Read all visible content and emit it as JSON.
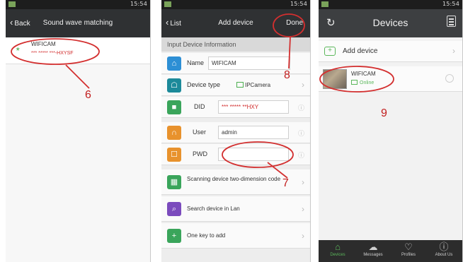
{
  "screen1": {
    "status_time": "15:54",
    "back_label": "Back",
    "title": "Sound wave matching",
    "device": {
      "name": "WIFICAM",
      "id": "*** ***** ***-HXYSF"
    },
    "annotation": "6"
  },
  "screen2": {
    "status_time": "15:54",
    "back_label": "List",
    "title": "Add device",
    "done_label": "Done",
    "section_label": "Input Device Information",
    "fields": {
      "name": {
        "label": "Name",
        "value": "WIFICAM"
      },
      "device_type": {
        "label": "Device type",
        "value": "IPCamera"
      },
      "did": {
        "label": "DID",
        "value": "*** ***** **HXY"
      },
      "user": {
        "label": "User",
        "value": "admin"
      },
      "pwd": {
        "label": "PWD",
        "value": ""
      }
    },
    "actions": [
      {
        "label": "Scanning device two-dimension code",
        "icon": "qrcode-icon"
      },
      {
        "label": "Search device in Lan",
        "icon": "search-icon"
      },
      {
        "label": "One key to add",
        "icon": "plus-icon"
      }
    ],
    "annotations": {
      "pwd": "7",
      "done": "8"
    }
  },
  "screen3": {
    "status_time": "15:54",
    "title": "Devices",
    "add_label": "Add device",
    "device": {
      "name": "WIFICAM",
      "status": "Online"
    },
    "tabs": [
      {
        "label": "Devices",
        "icon": "home-icon",
        "active": true
      },
      {
        "label": "Messages",
        "icon": "cloud-icon",
        "active": false
      },
      {
        "label": "Profiles",
        "icon": "heart-icon",
        "active": false
      },
      {
        "label": "About Us",
        "icon": "info-icon",
        "active": false
      }
    ],
    "annotation": "9"
  },
  "colors": {
    "annotation": "#c21e1e",
    "accent_green": "#5bb75b",
    "titlebar": "#2f3133"
  }
}
